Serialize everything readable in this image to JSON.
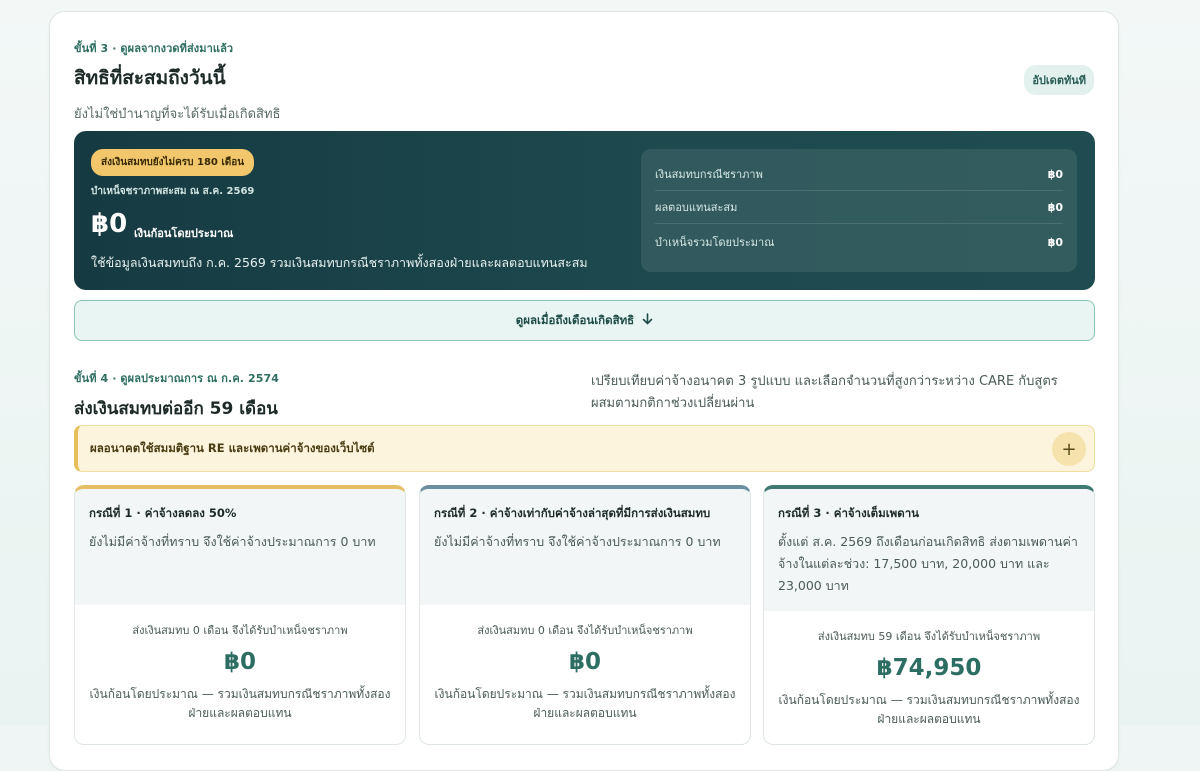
{
  "step3": {
    "label": "ขั้นที่ 3 · ดูผลจากงวดที่ส่งมาแล้ว",
    "title": "สิทธิที่สะสมถึงวันนี้",
    "subtitle": "ยังไม่ใช่บำนาญที่จะได้รับเมื่อเกิดสิทธิ",
    "update_badge": "อัปเดตทันที"
  },
  "summary_panel": {
    "warning_pill": "ส่งเงินสมทบยังไม่ครบ 180 เดือน",
    "caption": "บำเหน็จชราภาพสะสม ณ ส.ค. 2569",
    "amount": "฿0",
    "amount_note": "เงินก้อนโดยประมาณ",
    "description": "ใช้ข้อมูลเงินสมทบถึง ก.ค. 2569 รวมเงินสมทบกรณีชราภาพทั้งสองฝ่ายและผลตอบแทนสะสม",
    "rows": [
      {
        "label": "เงินสมทบกรณีชราภาพ",
        "value": "฿0"
      },
      {
        "label": "ผลตอบแทนสะสม",
        "value": "฿0"
      },
      {
        "label": "บำเหน็จรวมโดยประมาณ",
        "value": "฿0"
      }
    ]
  },
  "view_button": {
    "label": "ดูผลเมื่อถึงเดือนเกิดสิทธิ",
    "icon": "arrow-down-icon"
  },
  "step4": {
    "label": "ขั้นที่ 4 · ดูผลประมาณการ ณ ก.ค. 2574",
    "title": "ส่งเงินสมทบต่ออีก 59 เดือน",
    "description": "เปรียบเทียบค่าจ้างอนาคต 3 รูปแบบ และเลือกจำนวนที่สูงกว่าระหว่าง CARE กับสูตรผสมตามกติกาช่วงเปลี่ยนผ่าน"
  },
  "notice": {
    "text": "ผลอนาคตใช้สมมติฐาน RE และเพดานค่าจ้างของเว็บไซต์",
    "toggle": "+"
  },
  "cases": [
    {
      "title": "กรณีที่ 1 · ค่าจ้างลดลง 50%",
      "desc": "ยังไม่มีค่าจ้างที่ทราบ จึงใช้ค่าจ้างประมาณการ 0 บาท",
      "months": "ส่งเงินสมทบ 0 เดือน จึงได้รับบำเหน็จชราภาพ",
      "amount": "฿0",
      "note": "เงินก้อนโดยประมาณ — รวมเงินสมทบกรณีชราภาพทั้งสองฝ่ายและผลตอบแทน"
    },
    {
      "title": "กรณีที่ 2 · ค่าจ้างเท่ากับค่าจ้างล่าสุดที่มีการส่งเงินสมทบ",
      "desc": "ยังไม่มีค่าจ้างที่ทราบ จึงใช้ค่าจ้างประมาณการ 0 บาท",
      "months": "ส่งเงินสมทบ 0 เดือน จึงได้รับบำเหน็จชราภาพ",
      "amount": "฿0",
      "note": "เงินก้อนโดยประมาณ — รวมเงินสมทบกรณีชราภาพทั้งสองฝ่ายและผลตอบแทน"
    },
    {
      "title": "กรณีที่ 3 · ค่าจ้างเต็มเพดาน",
      "desc": "ตั้งแต่ ส.ค. 2569 ถึงเดือนก่อนเกิดสิทธิ ส่งตามเพดานค่าจ้างในแต่ละช่วง: 17,500 บาท, 20,000 บาท และ 23,000 บาท",
      "months": "ส่งเงินสมทบ 59 เดือน จึงได้รับบำเหน็จชราภาพ",
      "amount": "฿74,950",
      "note": "เงินก้อนโดยประมาณ — รวมเงินสมทบกรณีชราภาพทั้งสองฝ่ายและผลตอบแทน"
    }
  ]
}
